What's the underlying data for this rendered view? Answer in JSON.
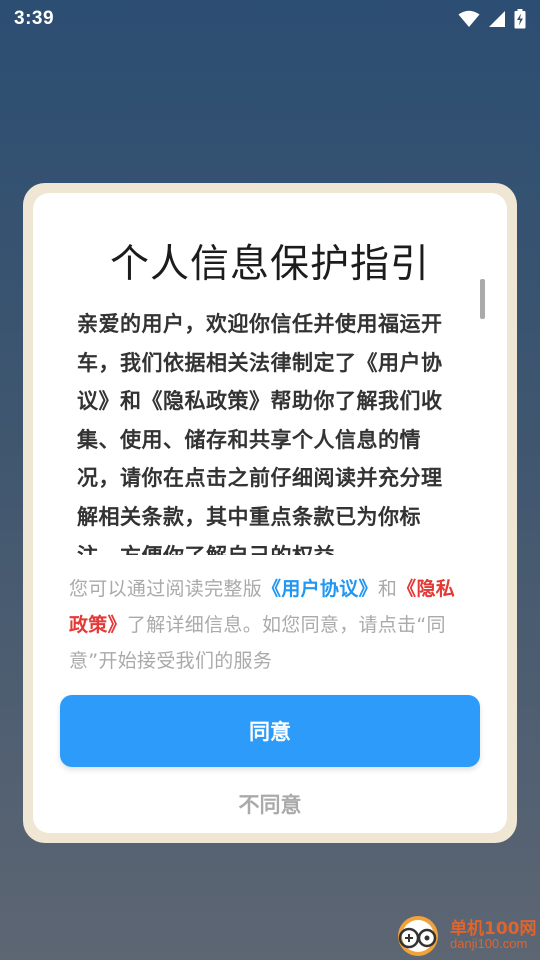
{
  "status_bar": {
    "time": "3:39",
    "icons": [
      "wifi-icon",
      "cell-signal-icon",
      "battery-charging-icon"
    ]
  },
  "dialog": {
    "title": "个人信息保护指引",
    "body": "亲爱的用户，欢迎你信任并使用福运开车，我们依据相关法律制定了《用户协议》和《隐私政策》帮助你了解我们收集、使用、储存和共享个人信息的情况，请你在点击之前仔细阅读并充分理解相关条款，其中重点条款已为你标注，方便你了解自己的权益",
    "notice": {
      "prefix": "您可以通过阅读完整版",
      "user_agreement_link": "《用户协议》",
      "middle": "和",
      "privacy_link": "《隐私政策》",
      "suffix": "了解详细信息。如您同意，请点击“同意”开始接受我们的服务"
    },
    "agree_label": "同意",
    "disagree_label": "不同意"
  },
  "watermark": {
    "name": "单机100网",
    "url": "danji100.com"
  },
  "colors": {
    "accent_blue": "#2c9bfa",
    "link_blue": "#2196f3",
    "link_red": "#e53935",
    "dialog_border": "#efe6d3"
  }
}
